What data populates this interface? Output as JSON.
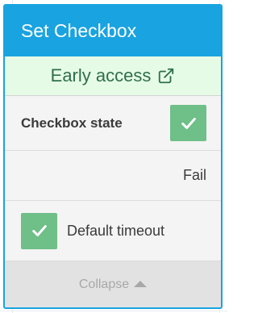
{
  "panel": {
    "title": "Set Checkbox",
    "early_access": {
      "label": "Early access",
      "icon": "external-link-icon"
    },
    "checkbox_state": {
      "label": "Checkbox state",
      "checked": true
    },
    "fail_label": "Fail",
    "default_timeout": {
      "label": "Default timeout",
      "checked": true
    },
    "collapse_label": "Collapse"
  },
  "colors": {
    "header_bg": "#19a3e0",
    "early_access_bg": "#e6fbe6",
    "early_access_text": "#2f6f4d",
    "checkbox_green": "#6ebf88",
    "collapse_bg": "#e2e2e2"
  }
}
